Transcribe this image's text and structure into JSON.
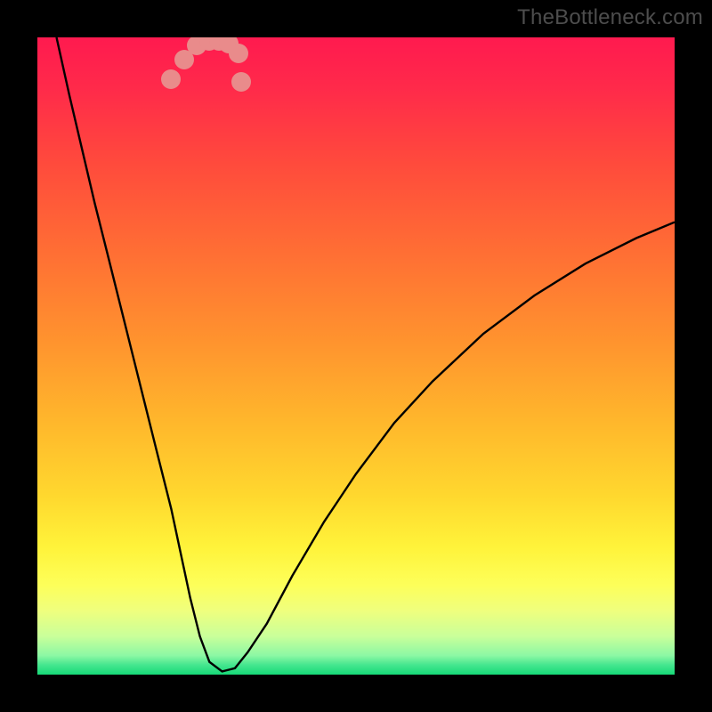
{
  "watermark": "TheBottleneck.com",
  "chart_data": {
    "type": "line",
    "title": "",
    "xlabel": "",
    "ylabel": "",
    "xlim": [
      0,
      100
    ],
    "ylim": [
      0,
      100
    ],
    "grid": false,
    "legend": false,
    "gradient_stops": [
      {
        "offset": 0.0,
        "color": "#ff1a4f"
      },
      {
        "offset": 0.08,
        "color": "#ff2a4a"
      },
      {
        "offset": 0.2,
        "color": "#ff4b3c"
      },
      {
        "offset": 0.34,
        "color": "#ff6f34"
      },
      {
        "offset": 0.48,
        "color": "#ff942e"
      },
      {
        "offset": 0.6,
        "color": "#ffb62c"
      },
      {
        "offset": 0.72,
        "color": "#ffd82e"
      },
      {
        "offset": 0.8,
        "color": "#fff33a"
      },
      {
        "offset": 0.86,
        "color": "#fdff5a"
      },
      {
        "offset": 0.9,
        "color": "#efff7e"
      },
      {
        "offset": 0.94,
        "color": "#c9ff9a"
      },
      {
        "offset": 0.97,
        "color": "#8cf8a4"
      },
      {
        "offset": 0.985,
        "color": "#44e68e"
      },
      {
        "offset": 1.0,
        "color": "#17d978"
      }
    ],
    "series": [
      {
        "name": "curve",
        "x": [
          3,
          5,
          7,
          9,
          11,
          13,
          15,
          17,
          19,
          21,
          22.5,
          24,
          25.5,
          27,
          29,
          31,
          33,
          36,
          40,
          45,
          50,
          56,
          62,
          70,
          78,
          86,
          94,
          100
        ],
        "y": [
          100,
          91,
          82.5,
          74,
          66,
          58,
          50,
          42,
          34,
          26,
          19,
          12,
          6,
          2,
          0.5,
          1,
          3.5,
          8,
          15.5,
          24,
          31.5,
          39.5,
          46,
          53.5,
          59.5,
          64.5,
          68.5,
          71
        ]
      }
    ],
    "marker_points": {
      "name": "highlight-dots",
      "x": [
        21.0,
        23.0,
        25.0,
        27.0,
        28.5,
        30.0,
        31.5,
        32.0
      ],
      "y": [
        93.5,
        96.5,
        98.7,
        99.5,
        99.5,
        99.0,
        97.5,
        93.0
      ]
    }
  }
}
